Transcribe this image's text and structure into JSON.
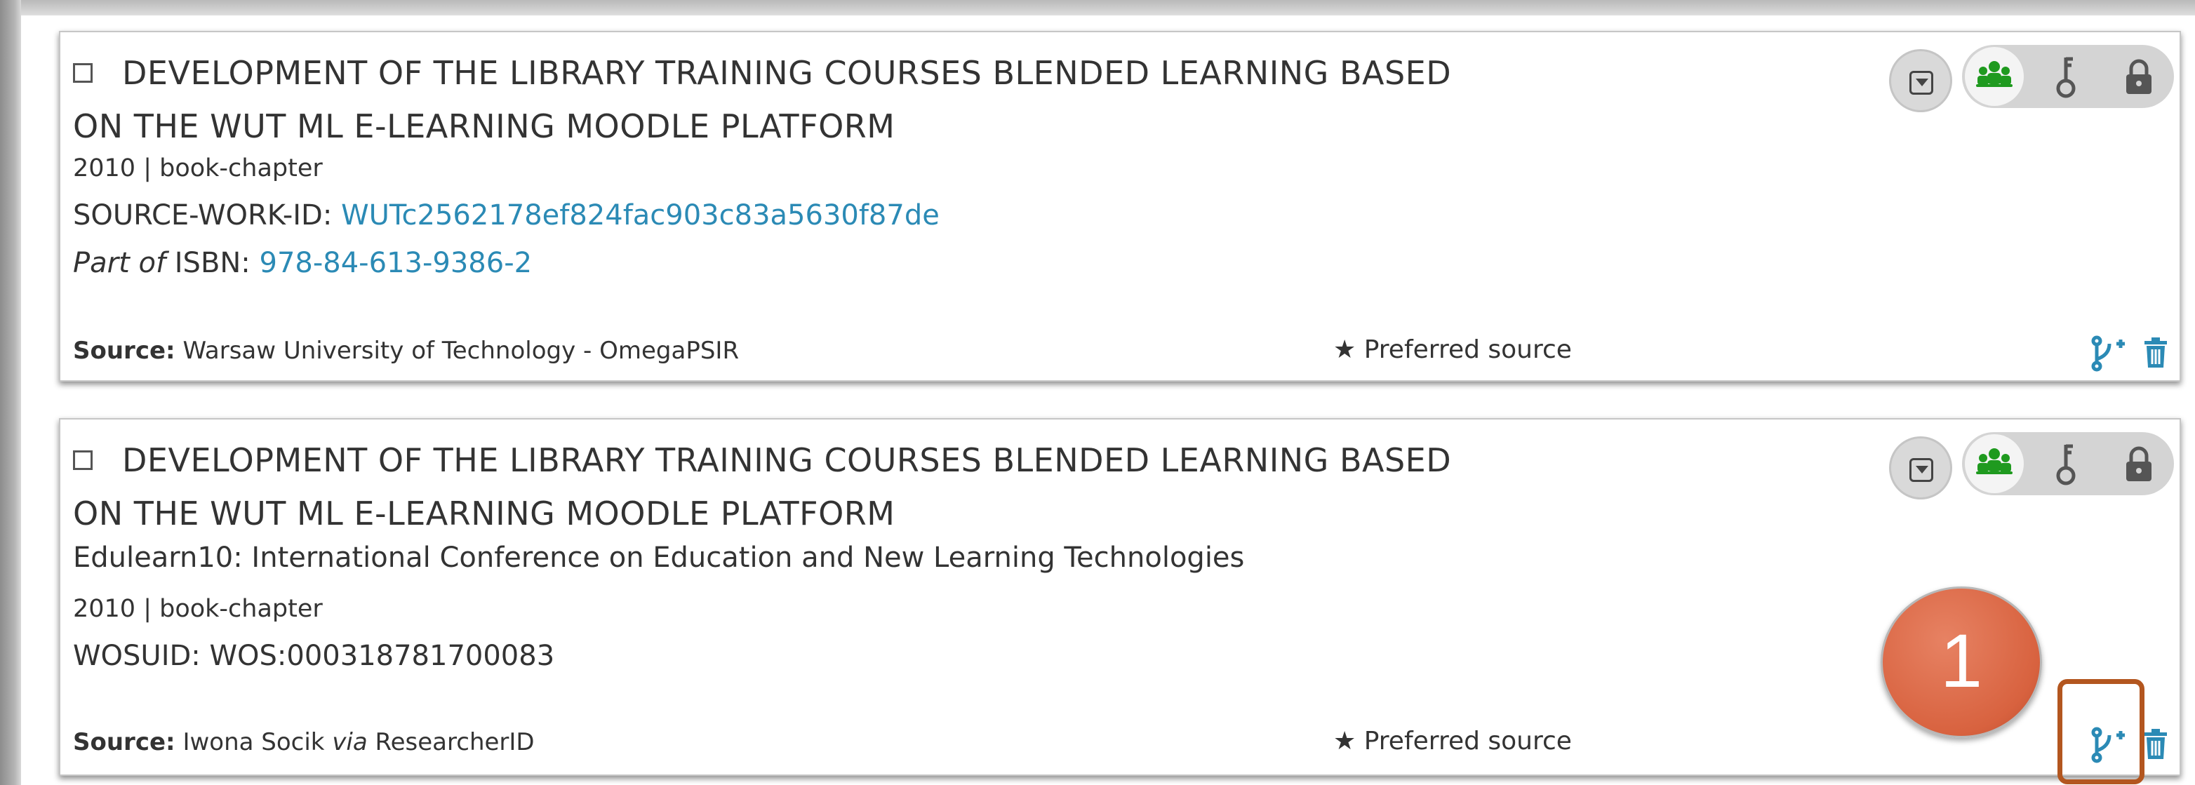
{
  "records": [
    {
      "title_line1": "DEVELOPMENT OF THE LIBRARY TRAINING COURSES BLENDED LEARNING BASED",
      "title_line2": "ON THE WUT ML E-LEARNING MOODLE PLATFORM",
      "meta": "2010 | book-chapter",
      "id_label": "SOURCE-WORK-ID:",
      "id_value": "WUTc2562178ef824fac903c83a5630f87de",
      "part_of": "Part of",
      "isbn_label": "ISBN:",
      "isbn_value": "978-84-613-9386-2",
      "source_label": "Source:",
      "source_value": "Warsaw University of Technology - OmegaPSIR",
      "preferred": "★ Preferred source"
    },
    {
      "title_line1": "DEVELOPMENT OF THE LIBRARY TRAINING COURSES BLENDED LEARNING BASED",
      "title_line2": "ON THE WUT ML E-LEARNING MOODLE PLATFORM",
      "journal": "Edulearn10: International Conference on Education and New Learning Technologies",
      "meta": "2010 | book-chapter",
      "id_label": "WOSUID:",
      "id_value": "WOS:000318781700083",
      "source_label": "Source:",
      "source_name": "Iwona Socik",
      "source_via": "via",
      "source_value": "ResearcherID",
      "preferred": "★ Preferred source"
    }
  ],
  "callout_number": "1",
  "icons": {
    "expand": "dropdown-caret-icon",
    "everyone": "group-icon",
    "limited": "key-icon",
    "private": "lock-icon",
    "combine": "combine-icon",
    "delete": "trash-icon"
  },
  "colors": {
    "accent_link": "#2b8ab5",
    "privacy_everyone": "#1f9a1f",
    "callout_fill": "#d8623f",
    "highlight_border": "#b3561f"
  }
}
